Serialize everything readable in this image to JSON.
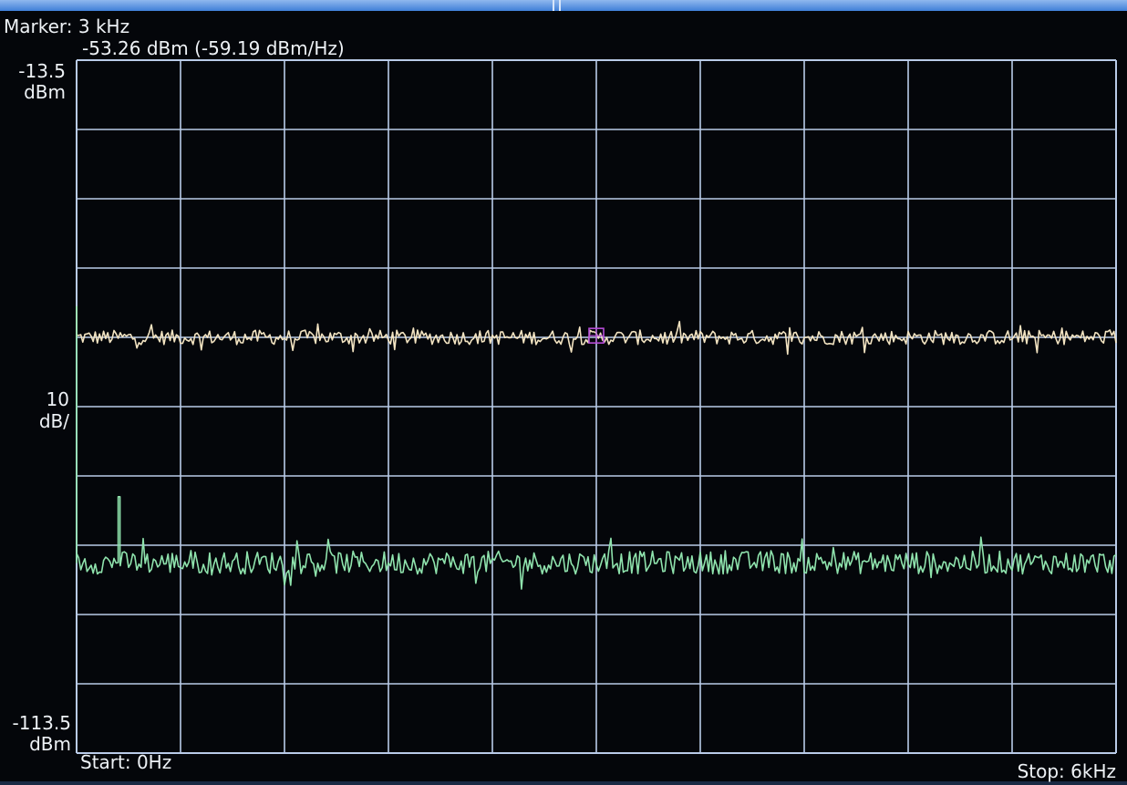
{
  "marker": {
    "line1": "Marker: 3 kHz",
    "line2": "-53.26 dBm (-59.19 dBm/Hz)"
  },
  "axis": {
    "ref_value": "-13.5",
    "ref_unit": "dBm",
    "scale_value": "10",
    "scale_unit": "dB/",
    "bottom_value": "-113.5",
    "bottom_unit": "dBm",
    "start_label": "Start: 0Hz",
    "stop_label": "Stop: 6kHz"
  },
  "colors": {
    "grid": "#b9cbe8",
    "trace1": "#f3e4c2",
    "trace2": "#8fe3ad",
    "marker": "#b44cd6",
    "background": "#04060a"
  },
  "chart_data": {
    "type": "line",
    "xlim": [
      0,
      6000
    ],
    "ylim": [
      -113.5,
      -13.5
    ],
    "x_divisions": 10,
    "y_divisions": 10,
    "grid": true,
    "x_unit": "Hz",
    "y_unit": "dBm",
    "series": [
      {
        "level": -53.5,
        "noise": 0.35,
        "color_key": "trace1",
        "start_spike": -49
      },
      {
        "level": -86.0,
        "noise": 0.55,
        "color_key": "trace2",
        "start_spike": -49,
        "spike_x": 240,
        "spike_level": -76.5
      }
    ],
    "marker": {
      "x": 3000,
      "y": -53.26
    }
  }
}
